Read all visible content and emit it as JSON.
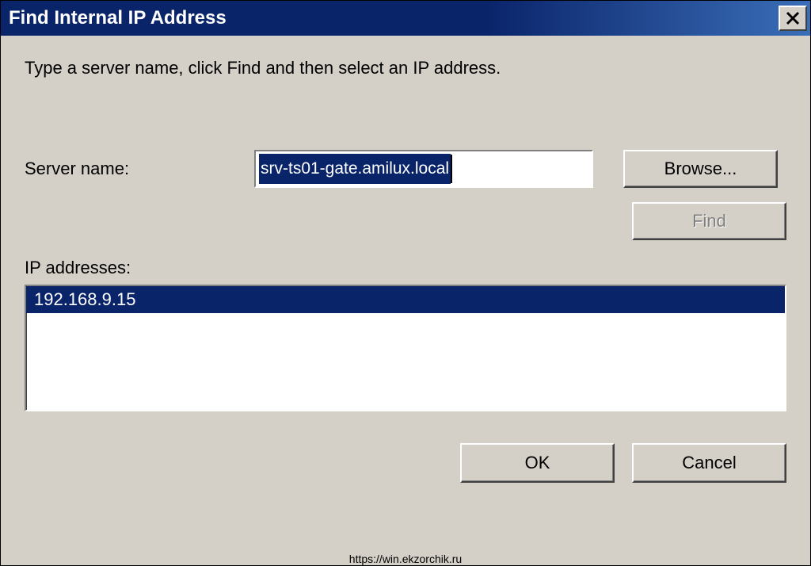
{
  "title": "Find Internal IP Address",
  "instruction": "Type a server name, click Find and then select an IP address.",
  "labels": {
    "server_name": "Server name:",
    "ip_addresses": "IP addresses:"
  },
  "input": {
    "server_name_value": "srv-ts01-gate.amilux.local"
  },
  "buttons": {
    "browse": "Browse...",
    "find": "Find",
    "ok": "OK",
    "cancel": "Cancel"
  },
  "ip_list": [
    "192.168.9.15"
  ],
  "watermark": "https://win.ekzorchik.ru"
}
